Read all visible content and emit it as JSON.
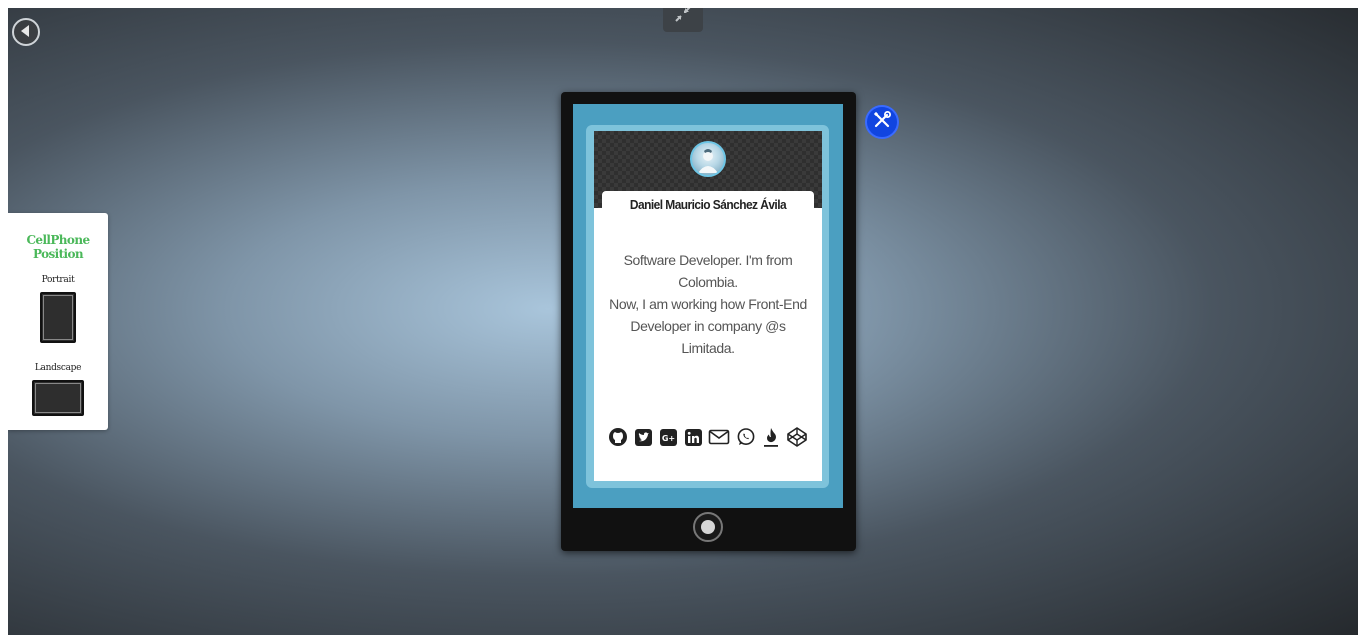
{
  "controls": {
    "back_icon": "arrow-left-circle-icon",
    "minimize_icon": "compress-icon",
    "tools_icon": "tools-icon"
  },
  "side_panel": {
    "title": "CellPhone Position",
    "options": [
      {
        "label": "Portrait"
      },
      {
        "label": "Landscape"
      }
    ]
  },
  "profile": {
    "name": "Daniel Mauricio Sánchez Ávila",
    "bio": "Software Developer. I'm from Colombia.\nNow, I am working how Front-End Developer in company @s Limitada.",
    "social_icons": [
      "github-icon",
      "twitter-icon",
      "google-plus-icon",
      "linkedin-icon",
      "email-icon",
      "whatsapp-icon",
      "codeigniter-icon",
      "codepen-icon"
    ]
  },
  "colors": {
    "screen_blue": "#4b9fc1",
    "accent_green": "#4bb85a",
    "tools_blue": "#1145e0"
  }
}
